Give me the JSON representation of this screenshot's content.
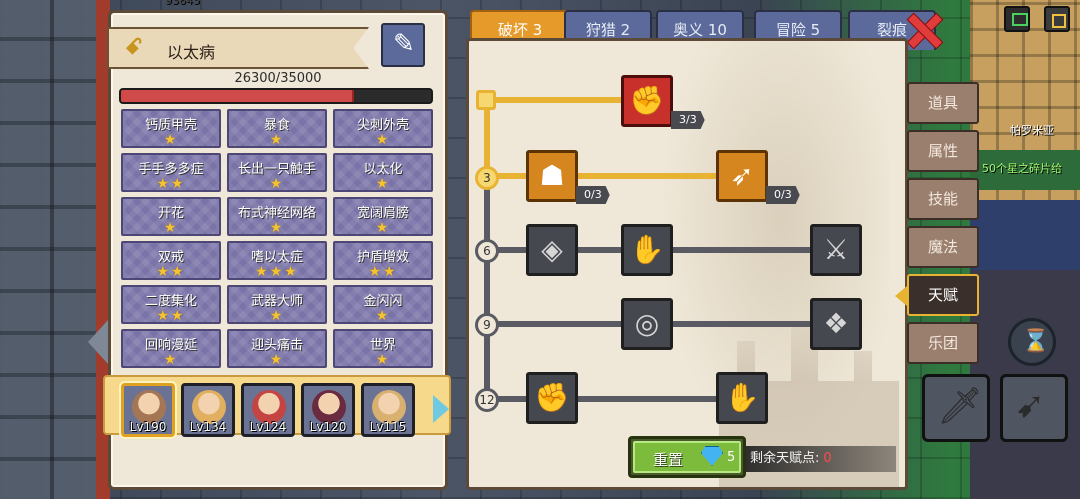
{
  "background": {
    "map_label_1": "帕罗米亚",
    "map_label_2": "50个星之碎片给",
    "top_label": "93845"
  },
  "character": {
    "name": "以太病",
    "hp_text": "26300/35000",
    "hp_current": 26300,
    "hp_max": 35000
  },
  "talents": [
    {
      "label": "钙质甲壳",
      "stars": "★"
    },
    {
      "label": "暴食",
      "stars": "★"
    },
    {
      "label": "尖刺外壳",
      "stars": "★"
    },
    {
      "label": "手手多多症",
      "stars": "★★"
    },
    {
      "label": "长出一只触手",
      "stars": "★"
    },
    {
      "label": "以太化",
      "stars": "★"
    },
    {
      "label": "开花",
      "stars": "★"
    },
    {
      "label": "布式神经网络",
      "stars": "★"
    },
    {
      "label": "宽阔肩膀",
      "stars": "★"
    },
    {
      "label": "双戒",
      "stars": "★★"
    },
    {
      "label": "嗜以太症",
      "stars": "★★★"
    },
    {
      "label": "护盾增效",
      "stars": "★★"
    },
    {
      "label": "二度集化",
      "stars": "★★"
    },
    {
      "label": "武器大师",
      "stars": "★"
    },
    {
      "label": "金闪闪",
      "stars": "★"
    },
    {
      "label": "回响漫延",
      "stars": "★"
    },
    {
      "label": "迎头痛击",
      "stars": "★"
    },
    {
      "label": "世界",
      "stars": "★"
    }
  ],
  "party": [
    {
      "level": "Lv190",
      "color": "#a57654"
    },
    {
      "level": "Lv134",
      "color": "#e0b060"
    },
    {
      "level": "Lv124",
      "color": "#c44444"
    },
    {
      "level": "Lv120",
      "color": "#6a2a40"
    },
    {
      "level": "Lv115",
      "color": "#d8b070"
    }
  ],
  "tabs": [
    {
      "label": "破坏 3",
      "active": true
    },
    {
      "label": "狩猎 2"
    },
    {
      "label": "奥义 10"
    },
    {
      "label": "冒险 5"
    },
    {
      "label": "裂痕"
    }
  ],
  "tree": {
    "tier_labels": [
      "3",
      "6",
      "9",
      "12"
    ],
    "skills": [
      {
        "name": "arm-wrestle",
        "glyph": "✊",
        "count": "3/3"
      },
      {
        "name": "muscle-body",
        "glyph": "☗",
        "count": "0/3"
      },
      {
        "name": "piercing-arrow",
        "glyph": "➶",
        "count": "0/3"
      },
      {
        "name": "rock-break",
        "glyph": "◈"
      },
      {
        "name": "crushing-fist",
        "glyph": "✋"
      },
      {
        "name": "slash-strike",
        "glyph": "⚔"
      },
      {
        "name": "shock-ring",
        "glyph": "◎"
      },
      {
        "name": "demon-wings",
        "glyph": "❖"
      },
      {
        "name": "power-fist",
        "glyph": "✊"
      },
      {
        "name": "stone-fist",
        "glyph": "✋"
      }
    ]
  },
  "reset": {
    "label": "重置",
    "cost": "5"
  },
  "remaining": {
    "label": "剩余天赋点:",
    "value": "0"
  },
  "side_menu": [
    {
      "label": "道具"
    },
    {
      "label": "属性"
    },
    {
      "label": "技能"
    },
    {
      "label": "魔法"
    },
    {
      "label": "天赋",
      "active": true
    },
    {
      "label": "乐团"
    }
  ]
}
